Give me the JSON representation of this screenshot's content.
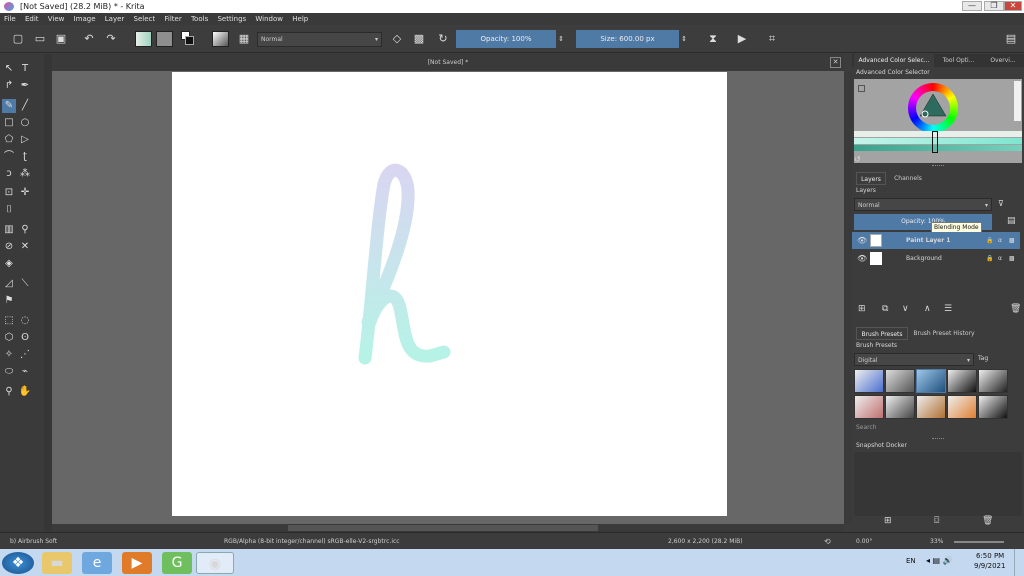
{
  "window": {
    "title": "[Not Saved]  (28.2 MiB)  * - Krita",
    "minimize_label": "—",
    "restore_label": "❐",
    "close_label": "✕"
  },
  "menu": [
    "File",
    "Edit",
    "View",
    "Image",
    "Layer",
    "Select",
    "Filter",
    "Tools",
    "Settings",
    "Window",
    "Help"
  ],
  "toolbar": {
    "blend_mode": "Normal",
    "opacity": "Opacity: 100%",
    "size": "Size: 600.00 px"
  },
  "document": {
    "tab_title": "[Not Saved]  *",
    "close_label": "✕"
  },
  "docker": {
    "top_tabs": [
      "Advanced Color Selec...",
      "Tool Opti...",
      "Overvi..."
    ],
    "color_selector_title": "Advanced Color Selector",
    "layer_tabs": [
      "Layers",
      "Channels"
    ],
    "layers_title": "Layers",
    "layers_blend_mode": "Normal",
    "layers_opacity": "Opacity: 100%",
    "tooltip": "Blending Mode",
    "layers": [
      {
        "name": "Paint Layer 1",
        "selected": true
      },
      {
        "name": "Background",
        "selected": false
      }
    ],
    "brush_tabs": [
      "Brush Presets",
      "Brush Preset History"
    ],
    "brush_presets_title": "Brush Presets",
    "brush_tag": "Digital",
    "tag_label": "Tag",
    "search_placeholder": "Search",
    "snapshot_title": "Snapshot Docker"
  },
  "status": {
    "brush": "b) Airbrush Soft",
    "color_space": "RGB/Alpha (8-bit integer/channel)  sRGB-elle-V2-srgbtrc.icc",
    "dimensions": "2,600 x 2,200 (28.2 MiB)",
    "rotation": "0.00°",
    "zoom": "33%"
  },
  "taskbar": {
    "language": "EN",
    "time": "6:50 PM",
    "date": "9/9/2021"
  },
  "colors": {
    "accent": "#4f7aa6",
    "stroke_top": "#d9d6f2",
    "stroke_bottom": "#b6f3e6"
  }
}
